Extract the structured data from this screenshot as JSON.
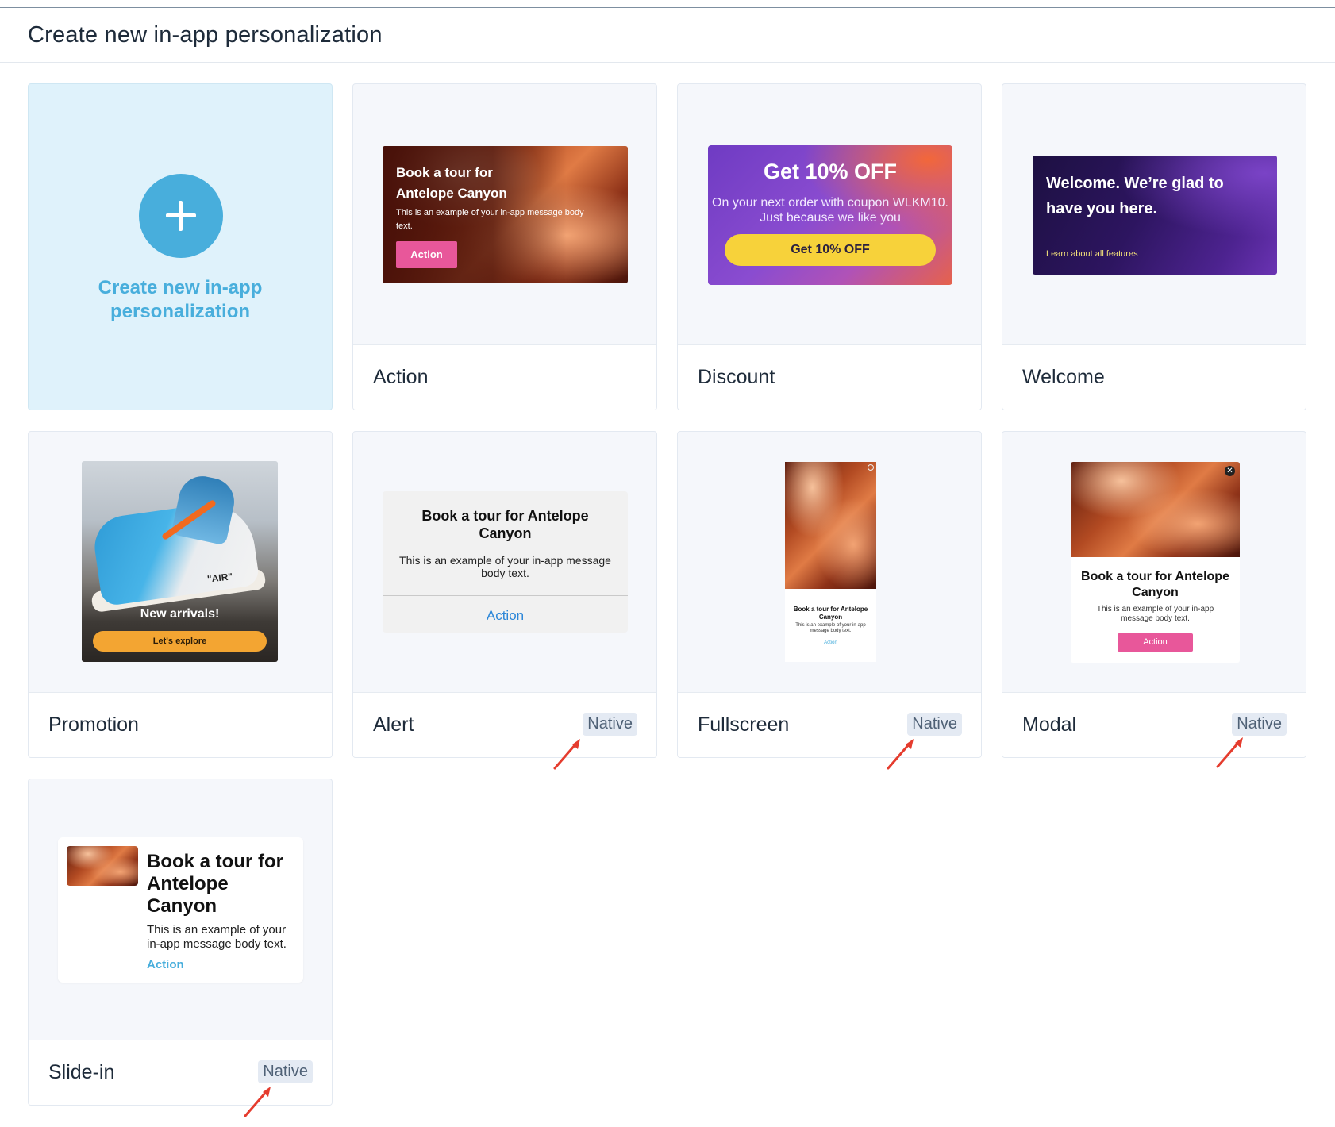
{
  "page": {
    "title": "Create new in-app personalization"
  },
  "create_card": {
    "label": "Create new in-app personalization"
  },
  "templates": [
    {
      "name": "Action",
      "badge": "",
      "preview": {
        "title": "Book a tour for Antelope Canyon",
        "body": "This is an example of your in-app message body text.",
        "button": "Action"
      }
    },
    {
      "name": "Discount",
      "badge": "",
      "preview": {
        "title": "Get 10% OFF",
        "body": "On your next order with coupon WLKM10. Just because we like you",
        "button": "Get 10% OFF"
      }
    },
    {
      "name": "Welcome",
      "badge": "",
      "preview": {
        "title": "Welcome. We’re glad to have you here.",
        "link": "Learn about all features"
      }
    },
    {
      "name": "Promotion",
      "badge": "",
      "preview": {
        "title": "New arrivals!",
        "button": "Let's explore",
        "shoe_text": "\"AIR\""
      }
    },
    {
      "name": "Alert",
      "badge": "Native",
      "preview": {
        "title": "Book a tour for Antelope Canyon",
        "body": "This is an example of your in-app message body text.",
        "action": "Action"
      }
    },
    {
      "name": "Fullscreen",
      "badge": "Native",
      "preview": {
        "title": "Book a tour for Antelope Canyon",
        "body": "This is an example of your in-app message body text.",
        "action": "Action"
      }
    },
    {
      "name": "Modal",
      "badge": "Native",
      "preview": {
        "title": "Book a tour for Antelope Canyon",
        "body": "This is an example of your in-app message body text.",
        "button": "Action"
      }
    },
    {
      "name": "Slide-in",
      "badge": "Native",
      "preview": {
        "title": "Book a tour for Antelope Canyon",
        "body": "This is an example of your in-app message body text.",
        "action": "Action"
      }
    }
  ],
  "colors": {
    "accent": "#48aedc",
    "create_card_bg": "#dff2fb",
    "action_button": "#e8579a",
    "discount_button": "#f7d23a",
    "badge_bg": "#e4eaf3",
    "annotation_arrow": "#e53c2e"
  },
  "icons": {
    "create": "plus-icon",
    "modal_close": "close-icon",
    "annotation": "arrow-annotation"
  }
}
